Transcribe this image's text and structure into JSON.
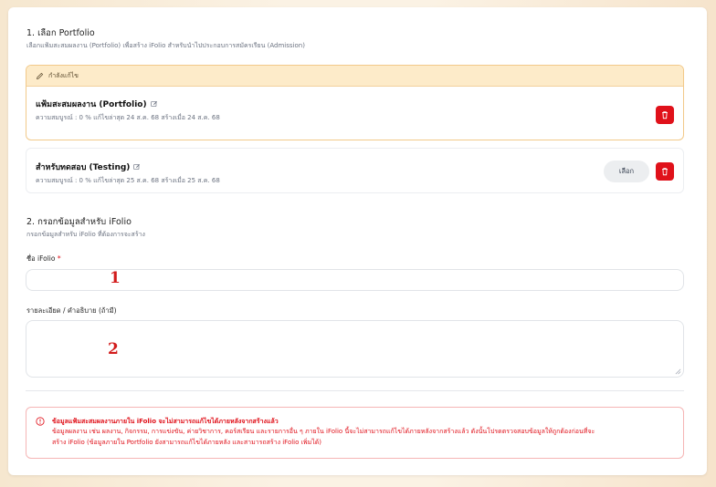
{
  "section1": {
    "title": "1. เลือก Portfolio",
    "subtitle": "เลือกแฟ้มสะสมผลงาน (Portfolio) เพื่อสร้าง iFolio สำหรับนำไปประกอบการสมัครเรียน (Admission)"
  },
  "editing_card": {
    "banner": "กำลังแก้ไข",
    "title": "แฟ้มสะสมผลงาน (Portfolio)",
    "meta": "ความสมบูรณ์ : 0 %  แก้ไขล่าสุด 24 ส.ค. 68  สร้างเมื่อ 24 ส.ค. 68"
  },
  "testing_card": {
    "title": "สำหรับทดสอบ (Testing)",
    "meta": "ความสมบูรณ์ : 0 %  แก้ไขล่าสุด 25 ส.ค. 68  สร้างเมื่อ 25 ส.ค. 68",
    "select_label": "เลือก"
  },
  "section2": {
    "title": "2. กรอกข้อมูลสำหรับ iFolio",
    "subtitle": "กรอกข้อมูลสำหรับ iFolio ที่ต้องการจะสร้าง"
  },
  "form": {
    "name_label": "ชื่อ iFolio",
    "required_mark": "*",
    "name_value": "",
    "desc_label": "รายละเอียด / คำอธิบาย (ถ้ามี)",
    "desc_value": "",
    "marker_1": "1",
    "marker_2": "2"
  },
  "warning": {
    "title": "ข้อมูลแฟ้มสะสมผลงานภายใน iFolio จะไม่สามารถแก้ไขได้ภายหลังจากสร้างแล้ว",
    "line1": "ข้อมูลผลงาน เช่น ผลงาน, กิจกรรม, การแข่งขัน, ค่ายวิชาการ, คอร์สเรียน และรายการอื่น ๆ ภายใน iFolio นี้จะไม่สามารถแก้ไขได้ภายหลังจากสร้างแล้ว ดังนั้นโปรดตรวจสอบข้อมูลให้ถูกต้องก่อนที่จะ",
    "line2": "สร้าง iFolio (ข้อมูลภายใน Portfolio ยังสามารถแก้ไขได้ภายหลัง และสามารถสร้าง iFolio เพิ่มได้)"
  },
  "colors": {
    "accent_red": "#e0111a",
    "editing_bg": "#fdebc9",
    "editing_border": "#f2c98a"
  }
}
